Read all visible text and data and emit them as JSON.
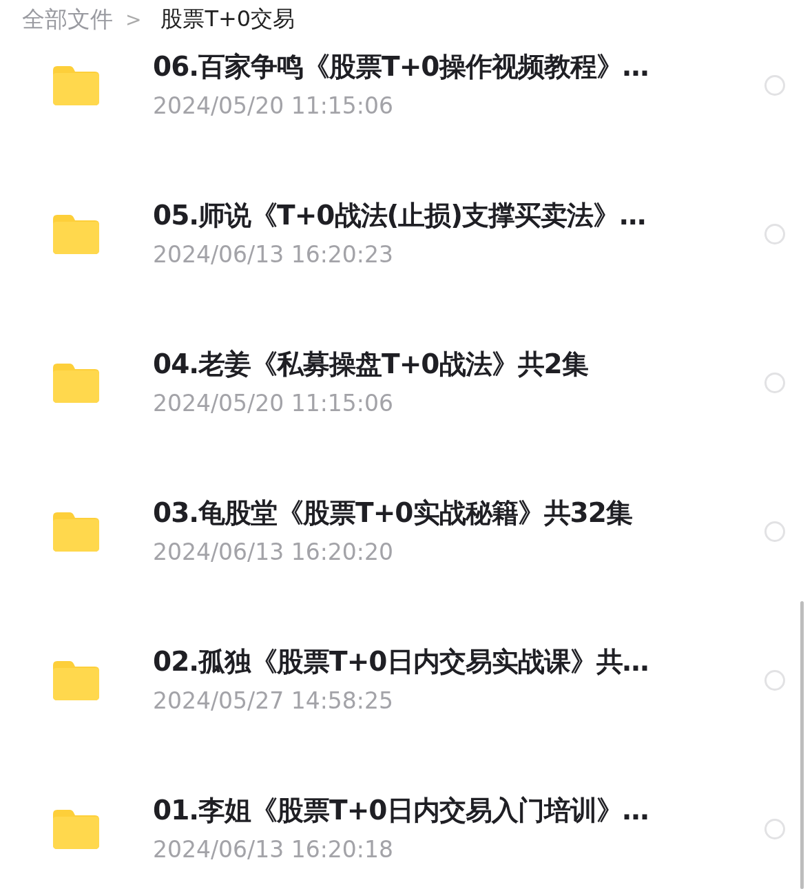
{
  "breadcrumb": [
    {
      "label": "全部文件",
      "current": false
    },
    {
      "label": "股票T+0交易",
      "current": true
    }
  ],
  "breadcrumb_separator": ">",
  "files": [
    {
      "name": "06.百家争鸣《股票T+0操作视频教程》…",
      "modified": "2024/05/20 11:15:06",
      "selected": false
    },
    {
      "name": "05.师说《T+0战法(止损)支撑买卖法》…",
      "modified": "2024/06/13 16:20:23",
      "selected": false
    },
    {
      "name": "04.老姜《私募操盘T+0战法》共2集",
      "modified": "2024/05/20 11:15:06",
      "selected": false
    },
    {
      "name": "03.龟股堂《股票T+0实战秘籍》共32集",
      "modified": "2024/06/13 16:20:20",
      "selected": false
    },
    {
      "name": "02.孤独《股票T+0日内交易实战课》共…",
      "modified": "2024/05/27 14:58:25",
      "selected": false
    },
    {
      "name": "01.李姐《股票T+0日内交易入门培训》…",
      "modified": "2024/06/13 16:20:18",
      "selected": false
    }
  ]
}
